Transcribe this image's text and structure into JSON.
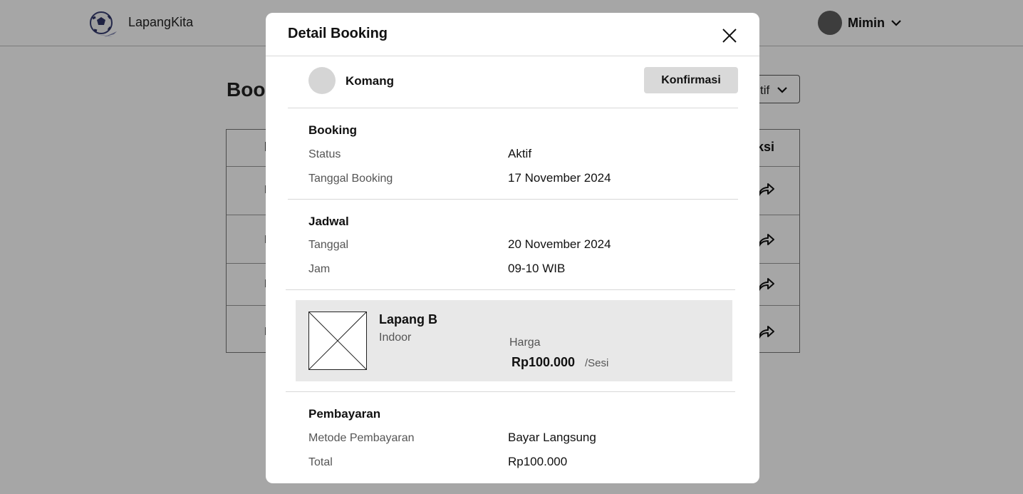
{
  "header": {
    "brand": "LapangKita",
    "user_name": "Mimin"
  },
  "background": {
    "page_title": "Book",
    "filter_label": "tif",
    "table": {
      "col_first": "N",
      "col_action": "ksi",
      "rows": [
        "K",
        "K",
        "K",
        "K"
      ]
    }
  },
  "modal": {
    "title": "Detail Booking",
    "customer": {
      "name": "Komang",
      "confirm_label": "Konfirmasi"
    },
    "booking": {
      "title": "Booking",
      "status_label": "Status",
      "status_value": "Aktif",
      "date_label": "Tanggal Booking",
      "date_value": "17 November 2024"
    },
    "schedule": {
      "title": "Jadwal",
      "date_label": "Tanggal",
      "date_value": "20 November 2024",
      "time_label": "Jam",
      "time_value": "09-10 WIB"
    },
    "field": {
      "name": "Lapang B",
      "type": "Indoor",
      "price_label": "Harga",
      "price": "Rp100.000",
      "unit": "/Sesi"
    },
    "payment": {
      "title": "Pembayaran",
      "method_label": "Metode Pembayaran",
      "method_value": "Bayar Langsung",
      "total_label": "Total",
      "total_value": "Rp100.000"
    }
  },
  "icons": {
    "logo": "soccer-ball-logo",
    "user_dropdown": "chevron-down-icon",
    "close": "close-icon",
    "row_action": "share-arrow-icon",
    "thumbnail": "image-placeholder-icon"
  },
  "colors": {
    "overlay": "#000000",
    "card_bg": "#e8e8e8",
    "button_bg": "#d9d9d9",
    "avatar_user": "#5f5f5f",
    "avatar_customer": "#d5d5d5"
  }
}
